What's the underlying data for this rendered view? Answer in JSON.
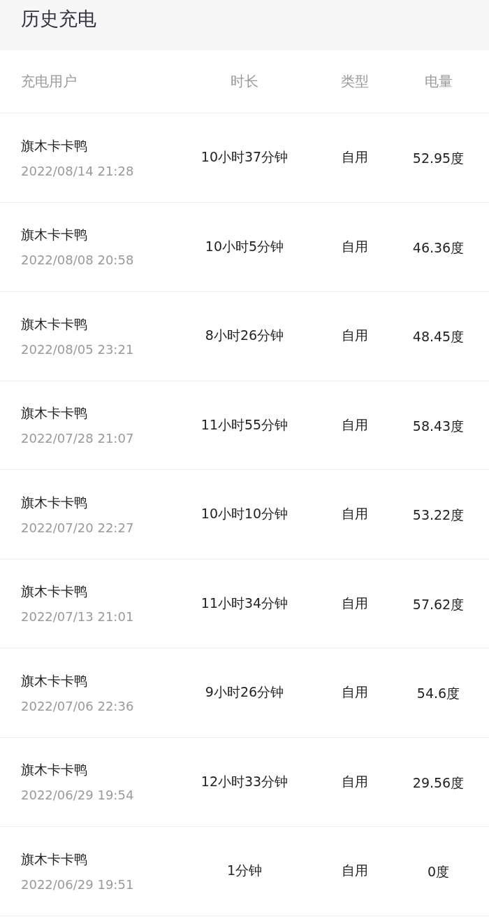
{
  "page": {
    "title": "历史充电"
  },
  "table": {
    "columns": [
      "充电用户",
      "时长",
      "类型",
      "电量"
    ],
    "rows": [
      {
        "user": "旗木卡卡鸭",
        "time": "2022/08/14 21:28",
        "duration": "10小时37分钟",
        "type": "自用",
        "energy": "52.95度"
      },
      {
        "user": "旗木卡卡鸭",
        "time": "2022/08/08 20:58",
        "duration": "10小时5分钟",
        "type": "自用",
        "energy": "46.36度"
      },
      {
        "user": "旗木卡卡鸭",
        "time": "2022/08/05 23:21",
        "duration": "8小时26分钟",
        "type": "自用",
        "energy": "48.45度"
      },
      {
        "user": "旗木卡卡鸭",
        "time": "2022/07/28 21:07",
        "duration": "11小时55分钟",
        "type": "自用",
        "energy": "58.43度"
      },
      {
        "user": "旗木卡卡鸭",
        "time": "2022/07/20 22:27",
        "duration": "10小时10分钟",
        "type": "自用",
        "energy": "53.22度"
      },
      {
        "user": "旗木卡卡鸭",
        "time": "2022/07/13 21:01",
        "duration": "11小时34分钟",
        "type": "自用",
        "energy": "57.62度"
      },
      {
        "user": "旗木卡卡鸭",
        "time": "2022/07/06 22:36",
        "duration": "9小时26分钟",
        "type": "自用",
        "energy": "54.6度"
      },
      {
        "user": "旗木卡卡鸭",
        "time": "2022/06/29 19:54",
        "duration": "12小时33分钟",
        "type": "自用",
        "energy": "29.56度"
      },
      {
        "user": "旗木卡卡鸭",
        "time": "2022/06/29 19:51",
        "duration": "1分钟",
        "type": "自用",
        "energy": "0度"
      }
    ]
  }
}
